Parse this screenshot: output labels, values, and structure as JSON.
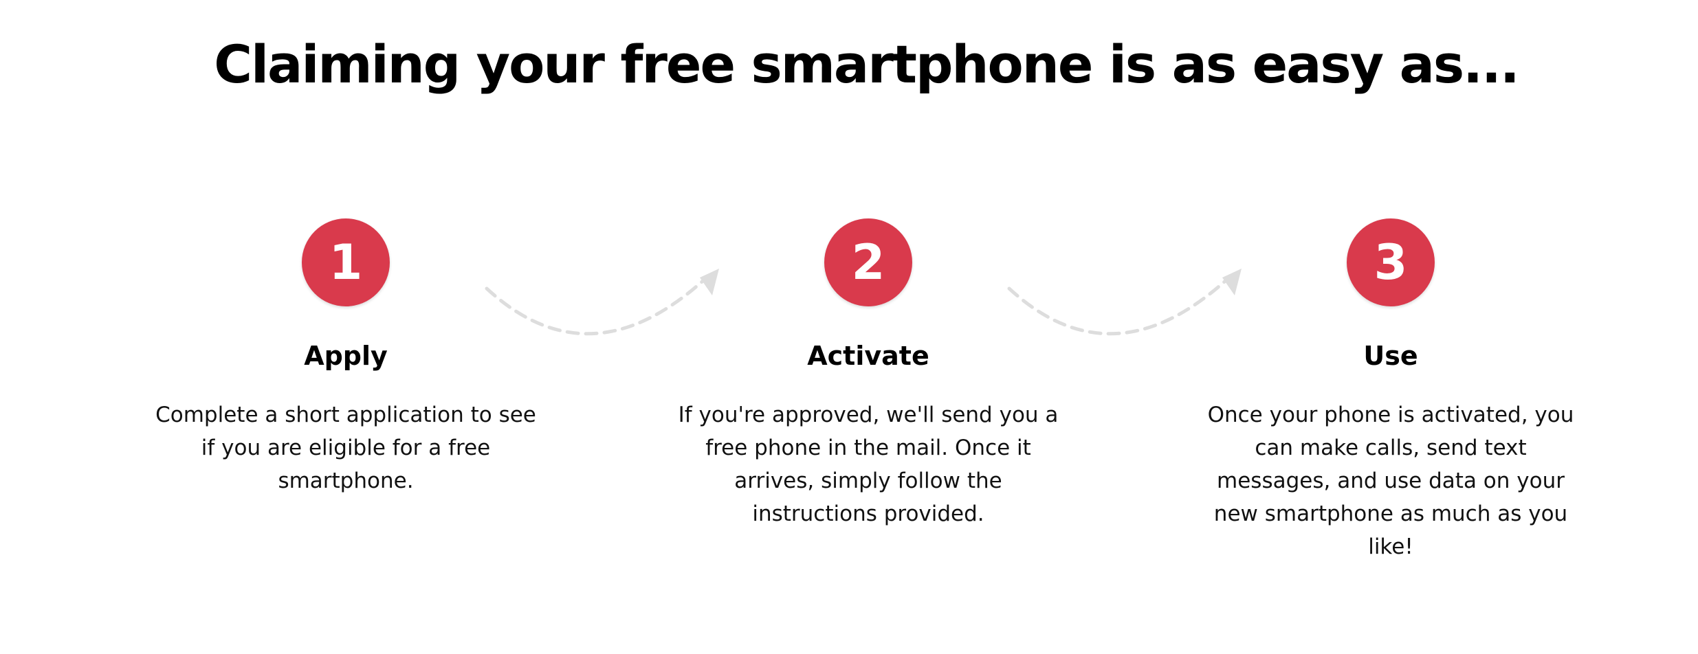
{
  "header": {
    "title": "Claiming your free smartphone is as easy as..."
  },
  "colors": {
    "badge": "#D93A4C",
    "arrow": "#DDDDDD"
  },
  "steps": [
    {
      "number": "1",
      "title": "Apply",
      "description": "Complete a short application to see if you are eligible for a free smartphone."
    },
    {
      "number": "2",
      "title": "Activate",
      "description": "If you're approved, we'll send you a free phone in the mail. Once it arrives, simply follow the instructions provided."
    },
    {
      "number": "3",
      "title": "Use",
      "description": "Once your phone is activated, you can make calls, send text messages, and use data on your new smartphone as much as you like!"
    }
  ]
}
